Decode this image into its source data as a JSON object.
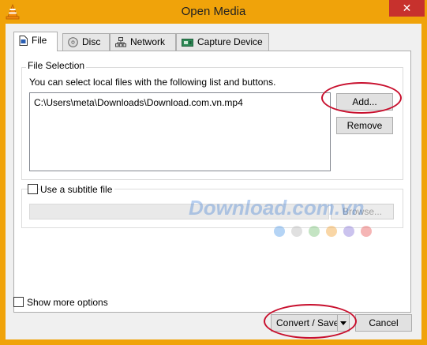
{
  "window": {
    "title": "Open Media",
    "close_label": "✕"
  },
  "tabs": [
    {
      "label": "File",
      "active": true
    },
    {
      "label": "Disc"
    },
    {
      "label": "Network"
    },
    {
      "label": "Capture Device"
    }
  ],
  "file_selection": {
    "group_label": "File Selection",
    "description": "You can select local files with the following list and buttons.",
    "files": [
      "C:\\Users\\meta\\Downloads\\Download.com.vn.mp4"
    ],
    "add_label": "Add...",
    "remove_label": "Remove"
  },
  "subtitle": {
    "checkbox_label": "Use a subtitle file",
    "checked": false,
    "browse_label": "Browse..."
  },
  "watermark": {
    "text": "Download.com.vn"
  },
  "footer": {
    "show_more_label": "Show more options",
    "convert_label": "Convert / Save",
    "cancel_label": "Cancel"
  },
  "colors": {
    "titlebar": "#f0a30a",
    "close": "#c7312d",
    "highlight_ellipse": "#c8102e"
  }
}
